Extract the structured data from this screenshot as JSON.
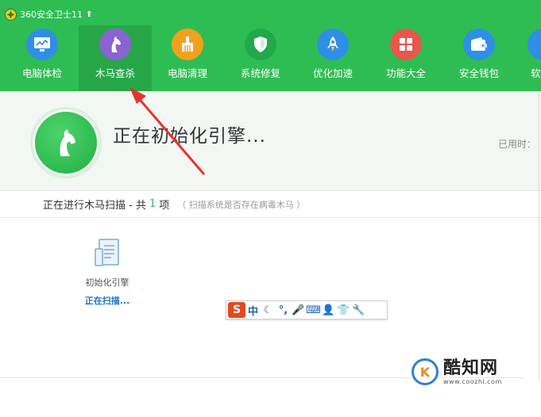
{
  "app": {
    "title": "360安全卫士11",
    "update_icon": "up-arrow-icon"
  },
  "nav": {
    "items": [
      {
        "label": "电脑体检",
        "icon": "monitor-chart-icon",
        "color": "#2f8fe6"
      },
      {
        "label": "木马查杀",
        "icon": "horse-icon",
        "color": "#8a63d2",
        "active": true
      },
      {
        "label": "电脑清理",
        "icon": "broom-icon",
        "color": "#f1a21d"
      },
      {
        "label": "系统修复",
        "icon": "shield-icon",
        "color": "#22a84a"
      },
      {
        "label": "优化加速",
        "icon": "rocket-icon",
        "color": "#2f8fe6"
      },
      {
        "label": "功能大全",
        "icon": "grid-icon",
        "color": "#e8574a"
      },
      {
        "label": "安全钱包",
        "icon": "wallet-icon",
        "color": "#2f8fe6"
      },
      {
        "label": "软",
        "icon": "app-icon",
        "color": "#2f8fe6"
      }
    ]
  },
  "status": {
    "title": "正在初始化引擎...",
    "elapsed_label": "已用时："
  },
  "scan": {
    "prefix": "正在进行木马扫描 - 共",
    "count": "1",
    "suffix": "项",
    "description": "（ 扫描系统是否存在病毒木马 ）"
  },
  "scan_item": {
    "label": "初始化引擎",
    "status": "正在扫描..."
  },
  "ime": {
    "logo": "S",
    "buttons": [
      "中",
      "☾",
      "°,",
      "🎤",
      "⌨",
      "👤",
      "👕",
      "🔧"
    ]
  },
  "watermark": {
    "name": "酷知网",
    "url": "www.coozhi.com"
  },
  "colors": {
    "brand_green": "#2ebd53",
    "active_tab": "#27a748",
    "arrow_red": "#e8322e"
  }
}
